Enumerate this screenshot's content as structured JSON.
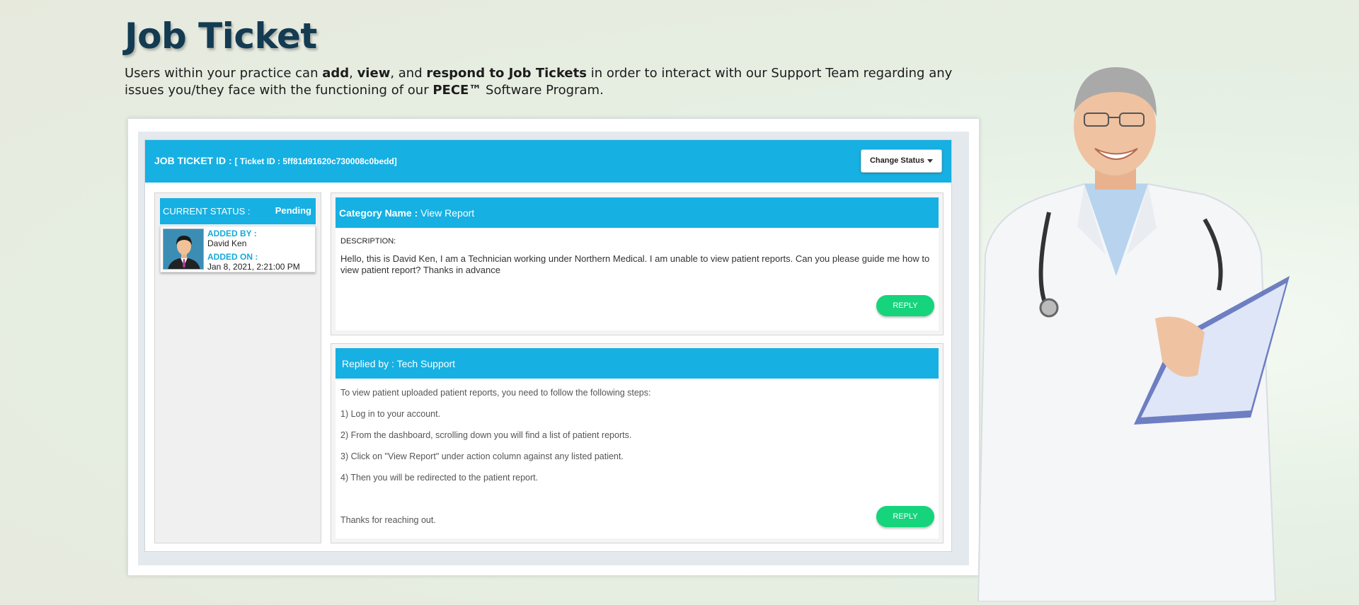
{
  "page": {
    "title": "Job Ticket",
    "intro": {
      "p1": "Users within your practice can ",
      "b1": "add",
      "p2": ", ",
      "b2": "view",
      "p3": ", and ",
      "b3": "respond to Job Tickets",
      "p4": " in order to interact with our Support Team regarding any issues you/they face with the functioning of our ",
      "b4": "PECE™",
      "p5": " Software Program."
    }
  },
  "ticket": {
    "header_label": "JOB TICKET ID : ",
    "header_id": "[ Ticket ID : 5ff81d91620c730008c0bedd]",
    "change_status_label": "Change Status"
  },
  "sidebar": {
    "status_label": "CURRENT STATUS :",
    "status_value": "Pending",
    "added_by_label": "ADDED BY :",
    "added_by_value": "David Ken",
    "added_on_label": "ADDED ON :",
    "added_on_value": "Jan 8, 2021, 2:21:00 PM"
  },
  "question": {
    "category_label": "Category Name : ",
    "category_value": "View Report",
    "description_label": "DESCRIPTION:",
    "description_text": "Hello, this is David Ken, I am a Technician working under Northern Medical. I am unable to view patient reports. Can you please guide me how to view patient report? Thanks in advance",
    "reply_label": "REPLY"
  },
  "answer": {
    "replied_by_label": "Replied by : Tech Support",
    "lines": [
      "To view patient uploaded patient reports, you need to follow the following steps:",
      "1) Log in to your account.",
      "2) From the dashboard, scrolling down you will find a list of patient reports.",
      "3) Click on \"View Report\" under action column against any listed patient.",
      "4) Then you will be redirected to the patient report.",
      "Thanks for reaching out."
    ],
    "reply_label": "REPLY"
  },
  "colors": {
    "header_blue": "#16b0e3",
    "reply_green": "#15d47c",
    "title_navy": "#133b52"
  },
  "icons": [
    "user-avatar-icon",
    "caret-down-icon",
    "doctor-illustration"
  ]
}
